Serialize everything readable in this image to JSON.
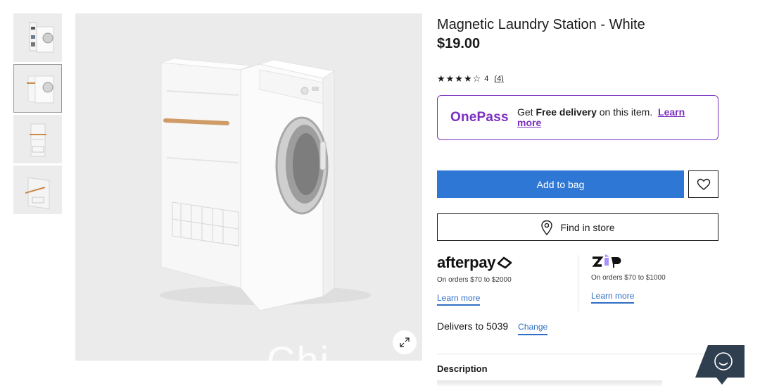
{
  "product": {
    "title": "Magnetic Laundry Station - White",
    "price": "$19.00",
    "rating": {
      "stars": 4,
      "max": 5,
      "value": "4",
      "count": "(4)"
    }
  },
  "gallery": {
    "thumbnails": [
      "thumbnail-1",
      "thumbnail-2",
      "thumbnail-3",
      "thumbnail-4"
    ],
    "active_index": 1,
    "watermark": "Chi..."
  },
  "onepass": {
    "logo": "OnePass",
    "text_prefix": "Get ",
    "text_bold": "Free delivery",
    "text_suffix": " on this item.",
    "link": "Learn more",
    "color": "#7b2fbf"
  },
  "actions": {
    "add_to_bag": "Add to bag",
    "find_in_store": "Find in store",
    "wishlist_icon": "heart-icon",
    "store_icon": "location-pin-icon",
    "accent_color": "#2f77d4"
  },
  "payments": {
    "afterpay": {
      "logo": "afterpay",
      "note": "On orders $70 to $2000",
      "link": "Learn more"
    },
    "zip": {
      "logo": "zip",
      "note": "On orders $70 to $1000",
      "link": "Learn more"
    }
  },
  "delivery": {
    "label": "Delivers to 5039",
    "change": "Change"
  },
  "description": {
    "heading": "Description"
  },
  "chat": {
    "icon": "smiley-chat-icon"
  }
}
